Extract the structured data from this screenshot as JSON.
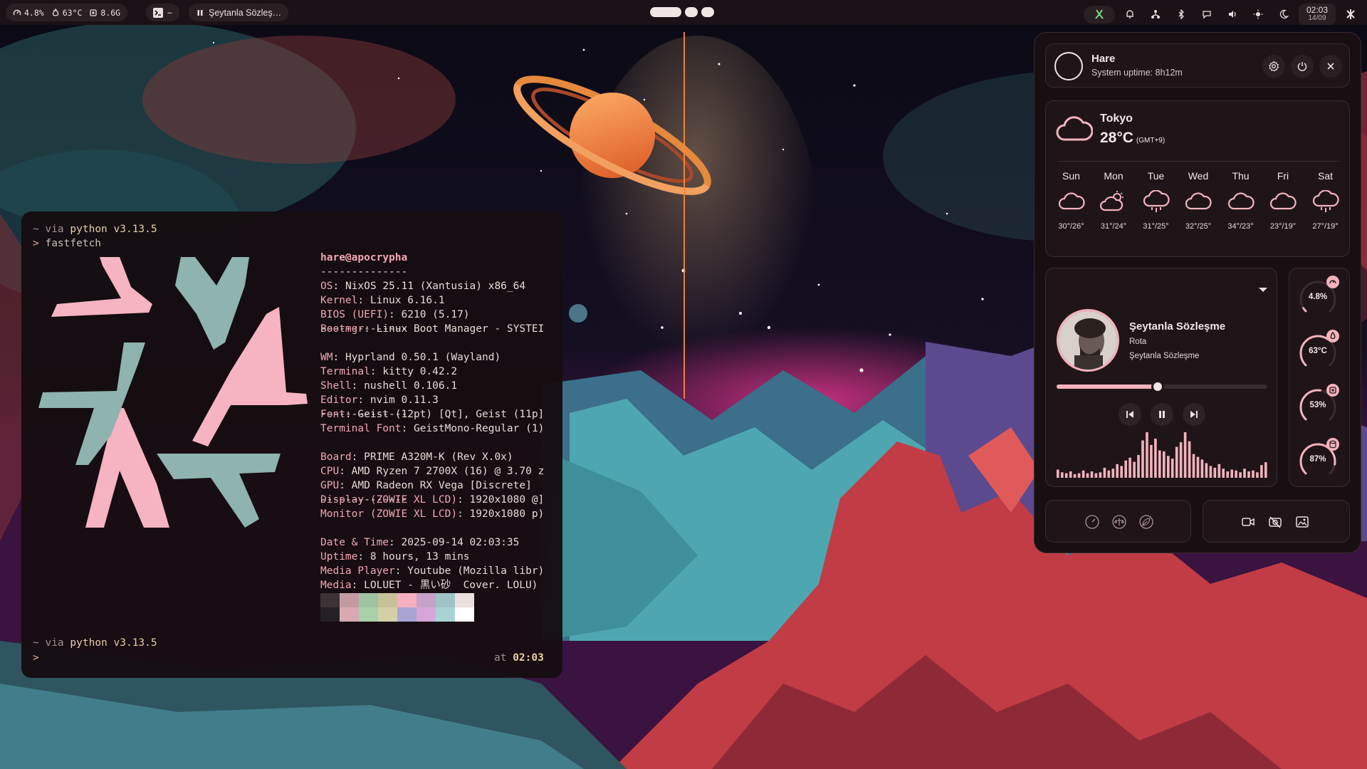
{
  "topbar": {
    "cpu": "4.8%",
    "temp": "63°C",
    "ram": "8.6G",
    "terminal_label": "~",
    "media_title": "Şeytanla Sözleş…",
    "clock_time": "02:03",
    "clock_date": "14/09"
  },
  "terminal": {
    "prompt_dir": "~",
    "prompt_via": "via",
    "prompt_python": "python v3.13.5",
    "prompt_char": ">",
    "command": "fastfetch",
    "userhost": "hare@apocrypha",
    "separator": "--------------",
    "info": [
      {
        "key": "OS",
        "value": "NixOS 25.11 (Xantusia) x86_64"
      },
      {
        "key": "Kernel",
        "value": "Linux 6.16.1"
      },
      {
        "key": "BIOS (UEFI)",
        "value": "6210 (5.17)"
      },
      {
        "key": "Bootmgr",
        "value": "Linux Boot Manager - SYSTEI"
      },
      {
        "key": "WM",
        "value": "Hyprland 0.50.1 (Wayland)"
      },
      {
        "key": "Terminal",
        "value": "kitty 0.42.2"
      },
      {
        "key": "Shell",
        "value": "nushell 0.106.1"
      },
      {
        "key": "Editor",
        "value": "nvim 0.11.3"
      },
      {
        "key": "Font",
        "value": "Geist (12pt) [Qt], Geist (11p]"
      },
      {
        "key": "Terminal Font",
        "value": "GeistMono-Regular (1)"
      },
      {
        "key": "Board",
        "value": "PRIME A320M-K (Rev X.0x)"
      },
      {
        "key": "CPU",
        "value": "AMD Ryzen 7 2700X (16) @ 3.70 z"
      },
      {
        "key": "GPU",
        "value": "AMD Radeon RX Vega [Discrete]"
      },
      {
        "key": "Display (ZOWIE XL LCD)",
        "value": "1920x1080 @]"
      },
      {
        "key": "Monitor (ZOWIE XL LCD)",
        "value": "1920x1080 p)"
      },
      {
        "key": "Date & Time",
        "value": "2025-09-14 02:03:35"
      },
      {
        "key": "Uptime",
        "value": "8 hours, 13 mins"
      },
      {
        "key": "Media Player",
        "value": "Youtube (Mozilla libr)"
      },
      {
        "key": "Media",
        "value": "LOLUET - 黒い砂  Cover. LOLU)"
      }
    ],
    "palette_top": [
      "#3b3336",
      "#c49aa2",
      "#9fc3a1",
      "#c7c19a",
      "#f7aec0",
      "#c6a1c8",
      "#9ec3c4",
      "#ecdfdf"
    ],
    "palette_bottom": [
      "#242024",
      "#d8a9b0",
      "#a8d0a9",
      "#d5cfa6",
      "#a9a4d4",
      "#d6a6d9",
      "#a8d3d3",
      "#ffffff"
    ],
    "time_prefix": "at",
    "time": "02:03"
  },
  "panel": {
    "profile": {
      "name": "Hare",
      "uptime": "System uptime: 8h12m"
    },
    "weather": {
      "city": "Tokyo",
      "temp": "28°C",
      "tz": "(GMT+9)",
      "forecast": [
        {
          "day": "Sun",
          "icon": "cloud-icon",
          "temps": "30°/26°"
        },
        {
          "day": "Mon",
          "icon": "partly-sunny-icon",
          "temps": "31°/24°"
        },
        {
          "day": "Tue",
          "icon": "rain-cloud-icon",
          "temps": "31°/25°"
        },
        {
          "day": "Wed",
          "icon": "cloud-icon",
          "temps": "32°/25°"
        },
        {
          "day": "Thu",
          "icon": "cloud-icon",
          "temps": "34°/23°"
        },
        {
          "day": "Fri",
          "icon": "cloud-icon",
          "temps": "23°/19°"
        },
        {
          "day": "Sat",
          "icon": "rain-cloud-icon",
          "temps": "27°/19°"
        }
      ]
    },
    "media": {
      "title": "Şeytanla Sözleşme",
      "album": "Rota",
      "artist": "Şeytanla Sözleşme",
      "progress": 0.48,
      "visualizer": [
        0.18,
        0.12,
        0.1,
        0.14,
        0.08,
        0.1,
        0.16,
        0.1,
        0.14,
        0.1,
        0.12,
        0.22,
        0.16,
        0.2,
        0.3,
        0.26,
        0.38,
        0.44,
        0.35,
        0.5,
        0.82,
        1.0,
        0.72,
        0.86,
        0.6,
        0.58,
        0.48,
        0.42,
        0.68,
        0.78,
        1.0,
        0.8,
        0.52,
        0.46,
        0.4,
        0.32,
        0.26,
        0.22,
        0.3,
        0.2,
        0.14,
        0.18,
        0.16,
        0.12,
        0.2,
        0.14,
        0.16,
        0.12,
        0.28,
        0.34
      ]
    },
    "stats": [
      {
        "value": "4.8%",
        "level": 0.048,
        "icon": "gauge-icon"
      },
      {
        "value": "63°C",
        "level": 0.63,
        "icon": "thermometer-icon"
      },
      {
        "value": "53%",
        "level": 0.53,
        "icon": "memory-icon"
      },
      {
        "value": "87%",
        "level": 0.87,
        "icon": "disk-icon"
      }
    ],
    "accent": "#f4b2bd"
  }
}
